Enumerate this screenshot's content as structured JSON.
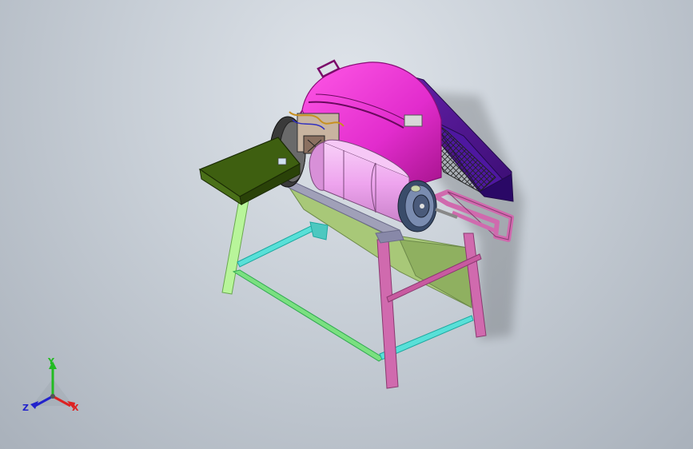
{
  "colors": {
    "hood": "#e82ad0",
    "hood_dark": "#b0129a",
    "chute": "#5a1a9a",
    "chute_dark": "#3a0d72",
    "drum": "#f0a8f0",
    "feed_tray": "#3e5f10",
    "cyan_frame": "#3ad6c8",
    "lime_leg": "#a8f08a",
    "magenta_leg": "#c85aa0",
    "olive_panel": "#a8c878",
    "pulley": "#6a7aa0",
    "background": "#c7ced6"
  },
  "triad": {
    "y_label": "Y",
    "x_label": "X",
    "z_label": "Z",
    "y_color": "#22bb22",
    "x_color": "#dd2222",
    "z_color": "#2222cc"
  },
  "icons": [
    "axis-triad-icon"
  ]
}
